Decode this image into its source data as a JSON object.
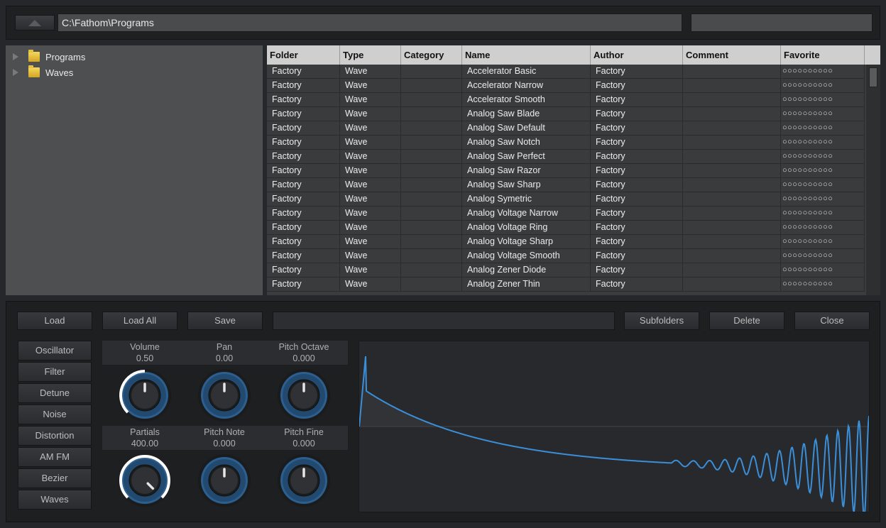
{
  "topbar": {
    "path": "C:\\Fathom\\Programs",
    "search": ""
  },
  "tree": {
    "items": [
      "Programs",
      "Waves"
    ]
  },
  "table": {
    "columns": [
      "Folder",
      "Type",
      "Category",
      "Name",
      "Author",
      "Comment",
      "Favorite"
    ],
    "rows": [
      [
        "Factory",
        "Wave",
        "",
        "Accelerator Basic",
        "Factory",
        "",
        "○○○○○○○○○○"
      ],
      [
        "Factory",
        "Wave",
        "",
        "Accelerator Narrow",
        "Factory",
        "",
        "○○○○○○○○○○"
      ],
      [
        "Factory",
        "Wave",
        "",
        "Accelerator Smooth",
        "Factory",
        "",
        "○○○○○○○○○○"
      ],
      [
        "Factory",
        "Wave",
        "",
        "Analog Saw Blade",
        "Factory",
        "",
        "○○○○○○○○○○"
      ],
      [
        "Factory",
        "Wave",
        "",
        "Analog Saw Default",
        "Factory",
        "",
        "○○○○○○○○○○"
      ],
      [
        "Factory",
        "Wave",
        "",
        "Analog Saw Notch",
        "Factory",
        "",
        "○○○○○○○○○○"
      ],
      [
        "Factory",
        "Wave",
        "",
        "Analog Saw Perfect",
        "Factory",
        "",
        "○○○○○○○○○○"
      ],
      [
        "Factory",
        "Wave",
        "",
        "Analog Saw Razor",
        "Factory",
        "",
        "○○○○○○○○○○"
      ],
      [
        "Factory",
        "Wave",
        "",
        "Analog Saw Sharp",
        "Factory",
        "",
        "○○○○○○○○○○"
      ],
      [
        "Factory",
        "Wave",
        "",
        "Analog Symetric",
        "Factory",
        "",
        "○○○○○○○○○○"
      ],
      [
        "Factory",
        "Wave",
        "",
        "Analog Voltage Narrow",
        "Factory",
        "",
        "○○○○○○○○○○"
      ],
      [
        "Factory",
        "Wave",
        "",
        "Analog Voltage Ring",
        "Factory",
        "",
        "○○○○○○○○○○"
      ],
      [
        "Factory",
        "Wave",
        "",
        "Analog Voltage Sharp",
        "Factory",
        "",
        "○○○○○○○○○○"
      ],
      [
        "Factory",
        "Wave",
        "",
        "Analog Voltage Smooth",
        "Factory",
        "",
        "○○○○○○○○○○"
      ],
      [
        "Factory",
        "Wave",
        "",
        "Analog Zener Diode",
        "Factory",
        "",
        "○○○○○○○○○○"
      ],
      [
        "Factory",
        "Wave",
        "",
        "Analog Zener Thin",
        "Factory",
        "",
        "○○○○○○○○○○"
      ]
    ]
  },
  "buttons": {
    "load": "Load",
    "load_all": "Load All",
    "save": "Save",
    "name_field": "",
    "subfolders": "Subfolders",
    "delete": "Delete",
    "close": "Close"
  },
  "sidebar": [
    "Oscillator",
    "Filter",
    "Detune",
    "Noise",
    "Distortion",
    "AM FM",
    "Bezier",
    "Waves"
  ],
  "knobs": [
    {
      "label": "Volume",
      "value": "0.50",
      "level": 0.5
    },
    {
      "label": "Pan",
      "value": "0.00",
      "level": 0
    },
    {
      "label": "Pitch Octave",
      "value": "0.000",
      "level": 0
    },
    {
      "label": "Partials",
      "value": "400.00",
      "level": 1.0
    },
    {
      "label": "Pitch Note",
      "value": "0.000",
      "level": 0
    },
    {
      "label": "Pitch Fine",
      "value": "0.000",
      "level": 0
    }
  ],
  "colors": {
    "accent": "#3a8fd8",
    "knob_ring": "#2f6fa8",
    "arc": "#ffffff"
  }
}
